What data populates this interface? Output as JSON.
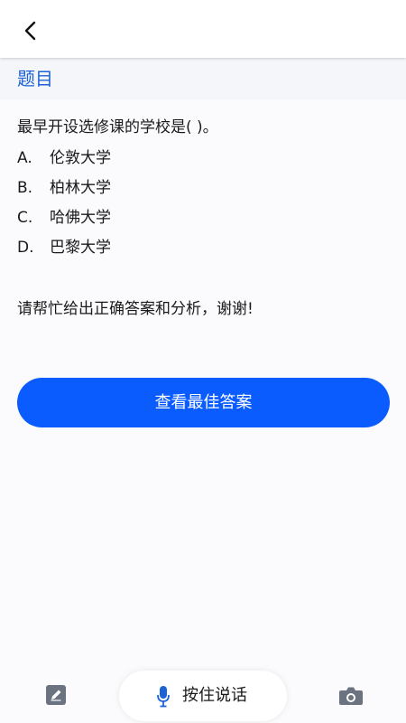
{
  "header": {
    "back_icon": "chevron-left-icon"
  },
  "section": {
    "title": "题目"
  },
  "question": {
    "text": "最早开设选修课的学校是( )。",
    "options": [
      {
        "letter": "A.",
        "text": "伦敦大学"
      },
      {
        "letter": "B.",
        "text": "柏林大学"
      },
      {
        "letter": "C.",
        "text": "哈佛大学"
      },
      {
        "letter": "D.",
        "text": "巴黎大学"
      }
    ],
    "request": "请帮忙给出正确答案和分析，谢谢!"
  },
  "actions": {
    "best_answer_label": "查看最佳答案"
  },
  "bottom_bar": {
    "edit_icon": "pencil-icon",
    "voice_icon": "microphone-icon",
    "voice_label": "按住说话",
    "camera_icon": "camera-icon"
  },
  "colors": {
    "accent": "#0b5cff",
    "title": "#1e63d6",
    "icon_gray": "#6b7280"
  }
}
